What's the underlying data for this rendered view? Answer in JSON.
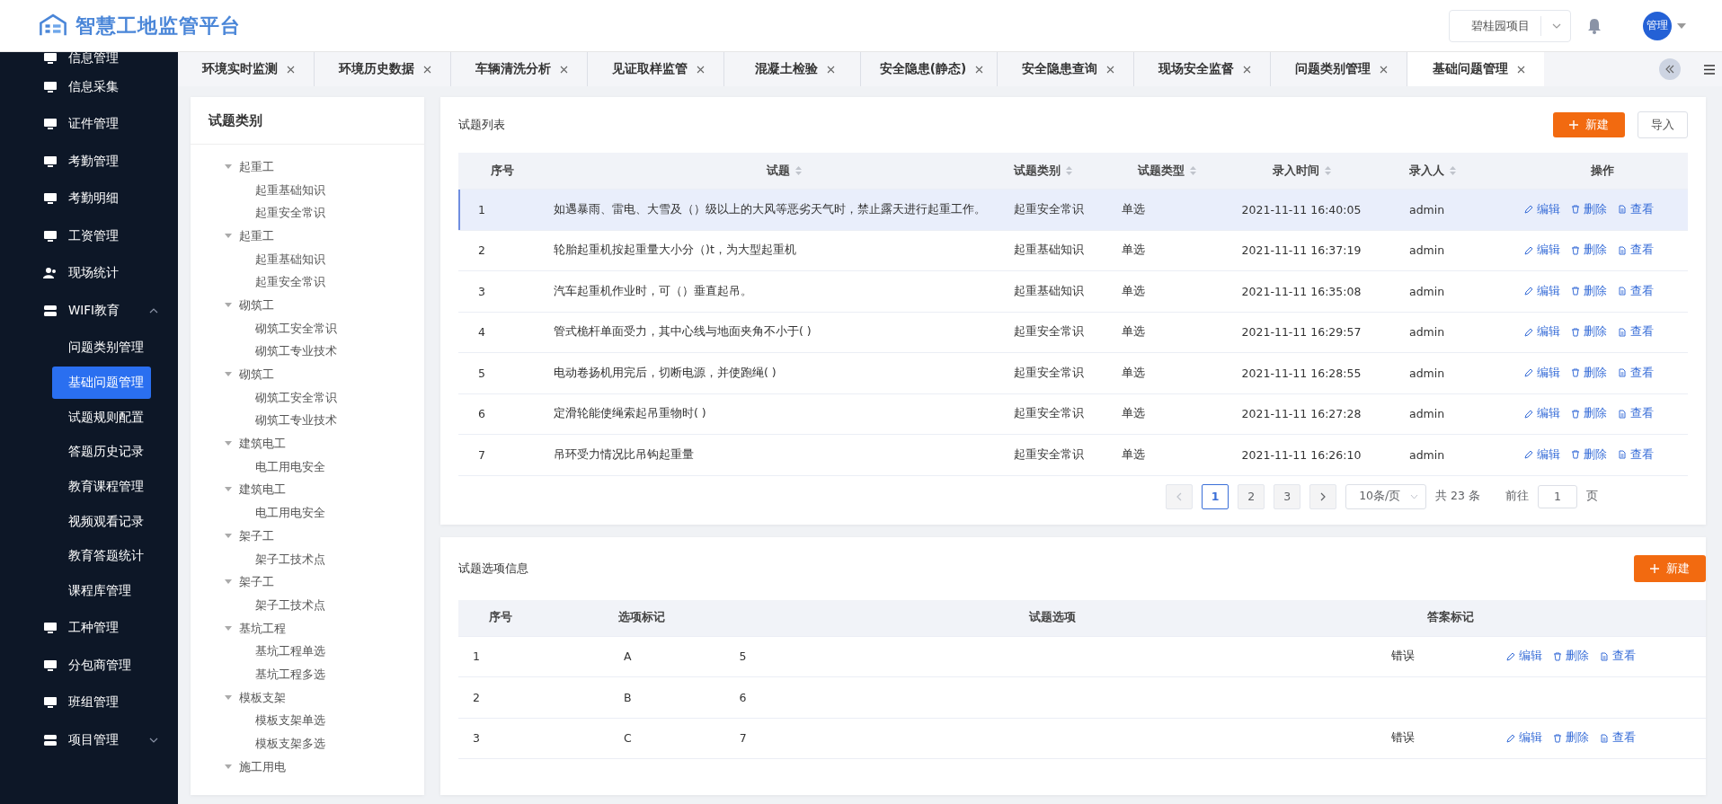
{
  "header": {
    "logo_text": "智慧工地监管平台",
    "project_select": "碧桂园项目",
    "avatar_text": "管理"
  },
  "tabs": [
    {
      "label": "环境实时监测",
      "selected": false
    },
    {
      "label": "环境历史数据",
      "selected": false
    },
    {
      "label": "车辆清洗分析",
      "selected": false
    },
    {
      "label": "见证取样监管",
      "selected": false
    },
    {
      "label": "混凝土检验",
      "selected": false
    },
    {
      "label": "安全隐患(静态)",
      "selected": false
    },
    {
      "label": "安全隐患查询",
      "selected": false
    },
    {
      "label": "现场安全监督",
      "selected": false
    },
    {
      "label": "问题类别管理",
      "selected": false
    },
    {
      "label": "基础问题管理",
      "selected": true
    }
  ],
  "sidebar": {
    "items": [
      {
        "label": "信息管理",
        "kind": "page"
      },
      {
        "label": "信息采集",
        "kind": "page"
      },
      {
        "label": "证件管理",
        "kind": "page"
      },
      {
        "label": "考勤管理",
        "kind": "page"
      },
      {
        "label": "考勤明细",
        "kind": "page"
      },
      {
        "label": "工资管理",
        "kind": "page"
      },
      {
        "label": "现场统计",
        "kind": "people"
      },
      {
        "label": "WIFI教育",
        "kind": "group",
        "expanded": true,
        "children": [
          {
            "label": "问题类别管理",
            "selected": false
          },
          {
            "label": "基础问题管理",
            "selected": true
          },
          {
            "label": "试题规则配置",
            "selected": false
          },
          {
            "label": "答题历史记录",
            "selected": false
          },
          {
            "label": "教育课程管理",
            "selected": false
          },
          {
            "label": "视频观看记录",
            "selected": false
          },
          {
            "label": "教育答题统计",
            "selected": false
          },
          {
            "label": "课程库管理",
            "selected": false
          }
        ]
      },
      {
        "label": "工种管理",
        "kind": "page"
      },
      {
        "label": "分包商管理",
        "kind": "page"
      },
      {
        "label": "班组管理",
        "kind": "page"
      },
      {
        "label": "项目管理",
        "kind": "group",
        "expanded": false
      }
    ]
  },
  "tree": {
    "title": "试题类别",
    "nodes": [
      {
        "label": "起重工",
        "expanded": true,
        "children": [
          {
            "label": "起重基础知识"
          },
          {
            "label": "起重安全常识"
          }
        ]
      },
      {
        "label": "起重工",
        "expanded": true,
        "children": [
          {
            "label": "起重基础知识"
          },
          {
            "label": "起重安全常识"
          }
        ]
      },
      {
        "label": "砌筑工",
        "expanded": true,
        "children": [
          {
            "label": "砌筑工安全常识"
          },
          {
            "label": "砌筑工专业技术"
          }
        ]
      },
      {
        "label": "砌筑工",
        "expanded": true,
        "children": [
          {
            "label": "砌筑工安全常识"
          },
          {
            "label": "砌筑工专业技术"
          }
        ]
      },
      {
        "label": "建筑电工",
        "expanded": true,
        "children": [
          {
            "label": "电工用电安全"
          }
        ]
      },
      {
        "label": "建筑电工",
        "expanded": true,
        "children": [
          {
            "label": "电工用电安全"
          }
        ]
      },
      {
        "label": "架子工",
        "expanded": true,
        "children": [
          {
            "label": "架子工技术点"
          }
        ]
      },
      {
        "label": "架子工",
        "expanded": true,
        "children": [
          {
            "label": "架子工技术点"
          }
        ]
      },
      {
        "label": "基坑工程",
        "expanded": true,
        "children": [
          {
            "label": "基坑工程单选"
          },
          {
            "label": "基坑工程多选"
          }
        ]
      },
      {
        "label": "模板支架",
        "expanded": true,
        "children": [
          {
            "label": "模板支架单选"
          },
          {
            "label": "模板支架多选"
          }
        ]
      },
      {
        "label": "施工用电",
        "expanded": true
      }
    ]
  },
  "question_list": {
    "title": "试题列表",
    "new_button": "新建",
    "import_button": "导入",
    "columns": [
      {
        "label": "序号",
        "sortable": false
      },
      {
        "label": "试题",
        "sortable": true
      },
      {
        "label": "试题类别",
        "sortable": true
      },
      {
        "label": "试题类型",
        "sortable": true
      },
      {
        "label": "录入时间",
        "sortable": true
      },
      {
        "label": "录入人",
        "sortable": true
      },
      {
        "label": "操作",
        "sortable": false
      }
    ],
    "rows": [
      {
        "selected": true,
        "cells": [
          "1",
          "如遇暴雨、雷电、大雪及（）级以上的大风等恶劣天气时，禁止露天进行起重工作。",
          "起重安全常识",
          "单选",
          "2021-11-11 16:40:05",
          "admin"
        ],
        "actions": [
          {
            "label": "编辑",
            "kind": "edit"
          },
          {
            "label": "删除",
            "kind": "delete"
          },
          {
            "label": "查看",
            "kind": "view"
          }
        ]
      },
      {
        "selected": false,
        "cells": [
          "2",
          "轮胎起重机按起重量大小分（)t，为大型起重机",
          "起重基础知识",
          "单选",
          "2021-11-11 16:37:19",
          "admin"
        ],
        "actions": [
          {
            "label": "编辑",
            "kind": "edit"
          },
          {
            "label": "删除",
            "kind": "delete"
          },
          {
            "label": "查看",
            "kind": "view"
          }
        ]
      },
      {
        "selected": false,
        "cells": [
          "3",
          "汽车起重机作业时，可（）垂直起吊。",
          "起重基础知识",
          "单选",
          "2021-11-11 16:35:08",
          "admin"
        ],
        "actions": [
          {
            "label": "编辑",
            "kind": "edit"
          },
          {
            "label": "删除",
            "kind": "delete"
          },
          {
            "label": "查看",
            "kind": "view"
          }
        ]
      },
      {
        "selected": false,
        "cells": [
          "4",
          "管式桅杆单面受力，其中心线与地面夹角不小于( )",
          "起重安全常识",
          "单选",
          "2021-11-11 16:29:57",
          "admin"
        ],
        "actions": [
          {
            "label": "编辑",
            "kind": "edit"
          },
          {
            "label": "删除",
            "kind": "delete"
          },
          {
            "label": "查看",
            "kind": "view"
          }
        ]
      },
      {
        "selected": false,
        "cells": [
          "5",
          "电动卷扬机用完后，切断电源，并使跑绳( )",
          "起重安全常识",
          "单选",
          "2021-11-11 16:28:55",
          "admin"
        ],
        "actions": [
          {
            "label": "编辑",
            "kind": "edit"
          },
          {
            "label": "删除",
            "kind": "delete"
          },
          {
            "label": "查看",
            "kind": "view"
          }
        ]
      },
      {
        "selected": false,
        "cells": [
          "6",
          "定滑轮能使绳索起吊重物时( )",
          "起重安全常识",
          "单选",
          "2021-11-11 16:27:28",
          "admin"
        ],
        "actions": [
          {
            "label": "编辑",
            "kind": "edit"
          },
          {
            "label": "删除",
            "kind": "delete"
          },
          {
            "label": "查看",
            "kind": "view"
          }
        ]
      },
      {
        "selected": false,
        "cells": [
          "7",
          "吊环受力情况比吊钩起重量",
          "起重安全常识",
          "单选",
          "2021-11-11 16:26:10",
          "admin"
        ],
        "actions": [
          {
            "label": "编辑",
            "kind": "edit"
          },
          {
            "label": "删除",
            "kind": "delete"
          },
          {
            "label": "查看",
            "kind": "view"
          }
        ]
      }
    ],
    "pagination": {
      "pages": [
        {
          "label": "1",
          "selected": true
        },
        {
          "label": "2",
          "selected": false
        },
        {
          "label": "3",
          "selected": false
        }
      ],
      "page_size": "10条/页",
      "total": "共 23 条",
      "goto_label": "前往",
      "goto_value": "1",
      "page_unit": "页"
    }
  },
  "option_info": {
    "title": "试题选项信息",
    "new_button": "新建",
    "columns": [
      "序号",
      "选项标记",
      "试题选项",
      "答案标记"
    ],
    "rows": [
      {
        "cells": [
          "1",
          "A",
          "5"
        ],
        "answer": "错误",
        "actions": [
          {
            "label": "编辑",
            "kind": "edit"
          },
          {
            "label": "删除",
            "kind": "delete"
          },
          {
            "label": "查看",
            "kind": "view"
          }
        ]
      },
      {
        "cells": [
          "2",
          "B",
          "6"
        ]
      },
      {
        "cells": [
          "3",
          "C",
          "7"
        ],
        "answer": "错误",
        "actions": [
          {
            "label": "编辑",
            "kind": "edit"
          },
          {
            "label": "删除",
            "kind": "delete"
          },
          {
            "label": "查看",
            "kind": "view"
          }
        ]
      }
    ]
  }
}
